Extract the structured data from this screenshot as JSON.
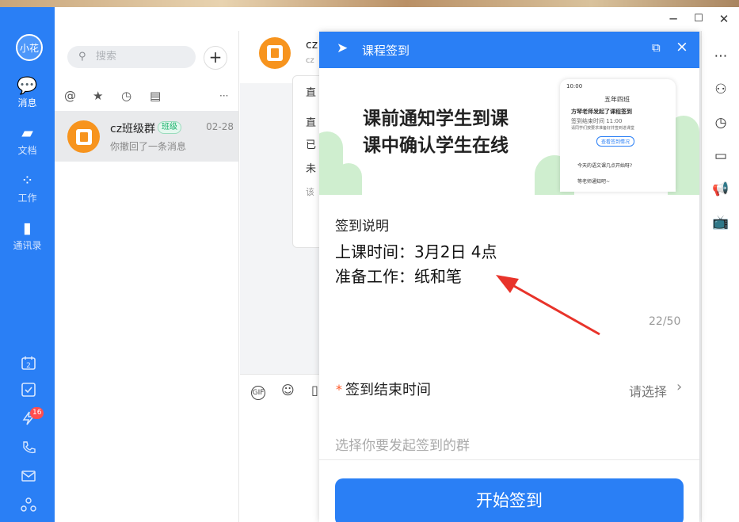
{
  "window": {
    "minimize_icon": "─",
    "maximize_icon": "☐",
    "close_icon": "✕"
  },
  "nav": {
    "avatar": "小花",
    "items": [
      {
        "label": "消息",
        "icon": "message-icon"
      },
      {
        "label": "文档",
        "icon": "doc-icon"
      },
      {
        "label": "工作",
        "icon": "apps-icon"
      },
      {
        "label": "通讯录",
        "icon": "contacts-icon"
      }
    ],
    "calendar_day": "2",
    "flash_badge": "16"
  },
  "list": {
    "search_placeholder": "搜索",
    "add": "+",
    "filter_more": "···",
    "conversation": {
      "name": "cz班级群",
      "tag": "班级",
      "time": "02-28",
      "last_message": "你撤回了一条消息"
    }
  },
  "chat": {
    "title": "cz",
    "subtitle": "cz",
    "bubble_lines": [
      "直",
      "直",
      "已",
      "未",
      "该"
    ],
    "gif": "GIF"
  },
  "dialog": {
    "title": "课程签到",
    "banner": {
      "line1": "课前通知学生到课",
      "line2": "课中确认学生在线",
      "phone": {
        "time": "10:00",
        "header": "五年四班",
        "msg_title": "方琴老师发起了课程签到",
        "msg_time": "签到结束时间 11:00",
        "msg_desc": "请同学们按要求准备好并签到进课堂",
        "btn": "查看签到情况",
        "chat1": "今天的语文课几点开始呀?",
        "chat2": "等老师通知吧~"
      }
    },
    "section_label": "签到说明",
    "description_lines": [
      "上课时间：3月2日 4点",
      "准备工作：纸和笔"
    ],
    "char_count": "22/50",
    "end_time": {
      "required_mark": "*",
      "label": "签到结束时间",
      "value": "请选择",
      "chevron": "›"
    },
    "group_placeholder": "选择你要发起签到的群",
    "start_button": "开始签到"
  },
  "annotation": {
    "color": "#e8332a"
  },
  "colors": {
    "brand_blue": "#2a7ff5",
    "badge_red": "#ff4d4f",
    "orange_avatar": "#f7941e"
  }
}
